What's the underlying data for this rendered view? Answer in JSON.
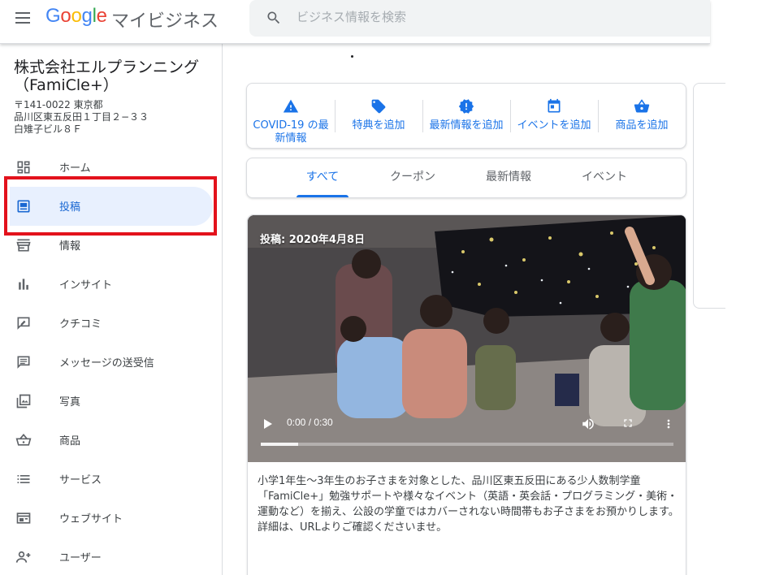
{
  "header": {
    "logo_letters": [
      "G",
      "o",
      "o",
      "g",
      "l",
      "e"
    ],
    "product_name": "マイビジネス",
    "search_placeholder": "ビジネス情報を検索"
  },
  "business": {
    "name": "株式会社エルプランニング（FamiCle+）",
    "address_lines": [
      "〒141-0022 東京都",
      "品川区東五反田１丁目２−３３",
      "白雉子ビル８Ｆ"
    ]
  },
  "sidebar": {
    "items": [
      {
        "label": "ホーム",
        "icon": "dashboard-icon"
      },
      {
        "label": "投稿",
        "icon": "posts-icon",
        "active": true
      },
      {
        "label": "情報",
        "icon": "storefront-icon"
      },
      {
        "label": "インサイト",
        "icon": "bar-chart-icon"
      },
      {
        "label": "クチコミ",
        "icon": "reviews-icon"
      },
      {
        "label": "メッセージの送受信",
        "icon": "message-icon"
      },
      {
        "label": "写真",
        "icon": "photo-icon"
      },
      {
        "label": "商品",
        "icon": "basket-icon"
      },
      {
        "label": "サービス",
        "icon": "list-icon"
      },
      {
        "label": "ウェブサイト",
        "icon": "website-icon"
      },
      {
        "label": "ユーザー",
        "icon": "add-user-icon"
      }
    ]
  },
  "actions": [
    {
      "label": "COVID-19 の最新情報",
      "icon": "warning-icon"
    },
    {
      "label": "特典を追加",
      "icon": "tag-icon"
    },
    {
      "label": "最新情報を追加",
      "icon": "badge-alert-icon"
    },
    {
      "label": "イベントを追加",
      "icon": "calendar-icon"
    },
    {
      "label": "商品を追加",
      "icon": "basket-icon"
    }
  ],
  "tabs": [
    {
      "label": "すべて",
      "active": true
    },
    {
      "label": "クーポン"
    },
    {
      "label": "最新情報"
    },
    {
      "label": "イベント"
    }
  ],
  "post": {
    "date_label": "投稿: 2020年4月8日",
    "video_time": "0:00 / 0:30",
    "progress": 0.09,
    "body": "小学1年生〜3年生のお子さまを対象とした、品川区東五反田にある少人数制学童「FamiCle+」勉強サポートや様々なイベント（英語・英会話・プログラミング・美術・運動など）を揃え、公設の学童ではカバーされない時間帯もお子さまをお預かりします。",
    "body2": "詳細は、URLよりご確認くださいませ。"
  },
  "colors": {
    "accent": "#1a73e8",
    "active_bg": "#e8f0fe",
    "highlight": "#e3121c"
  }
}
